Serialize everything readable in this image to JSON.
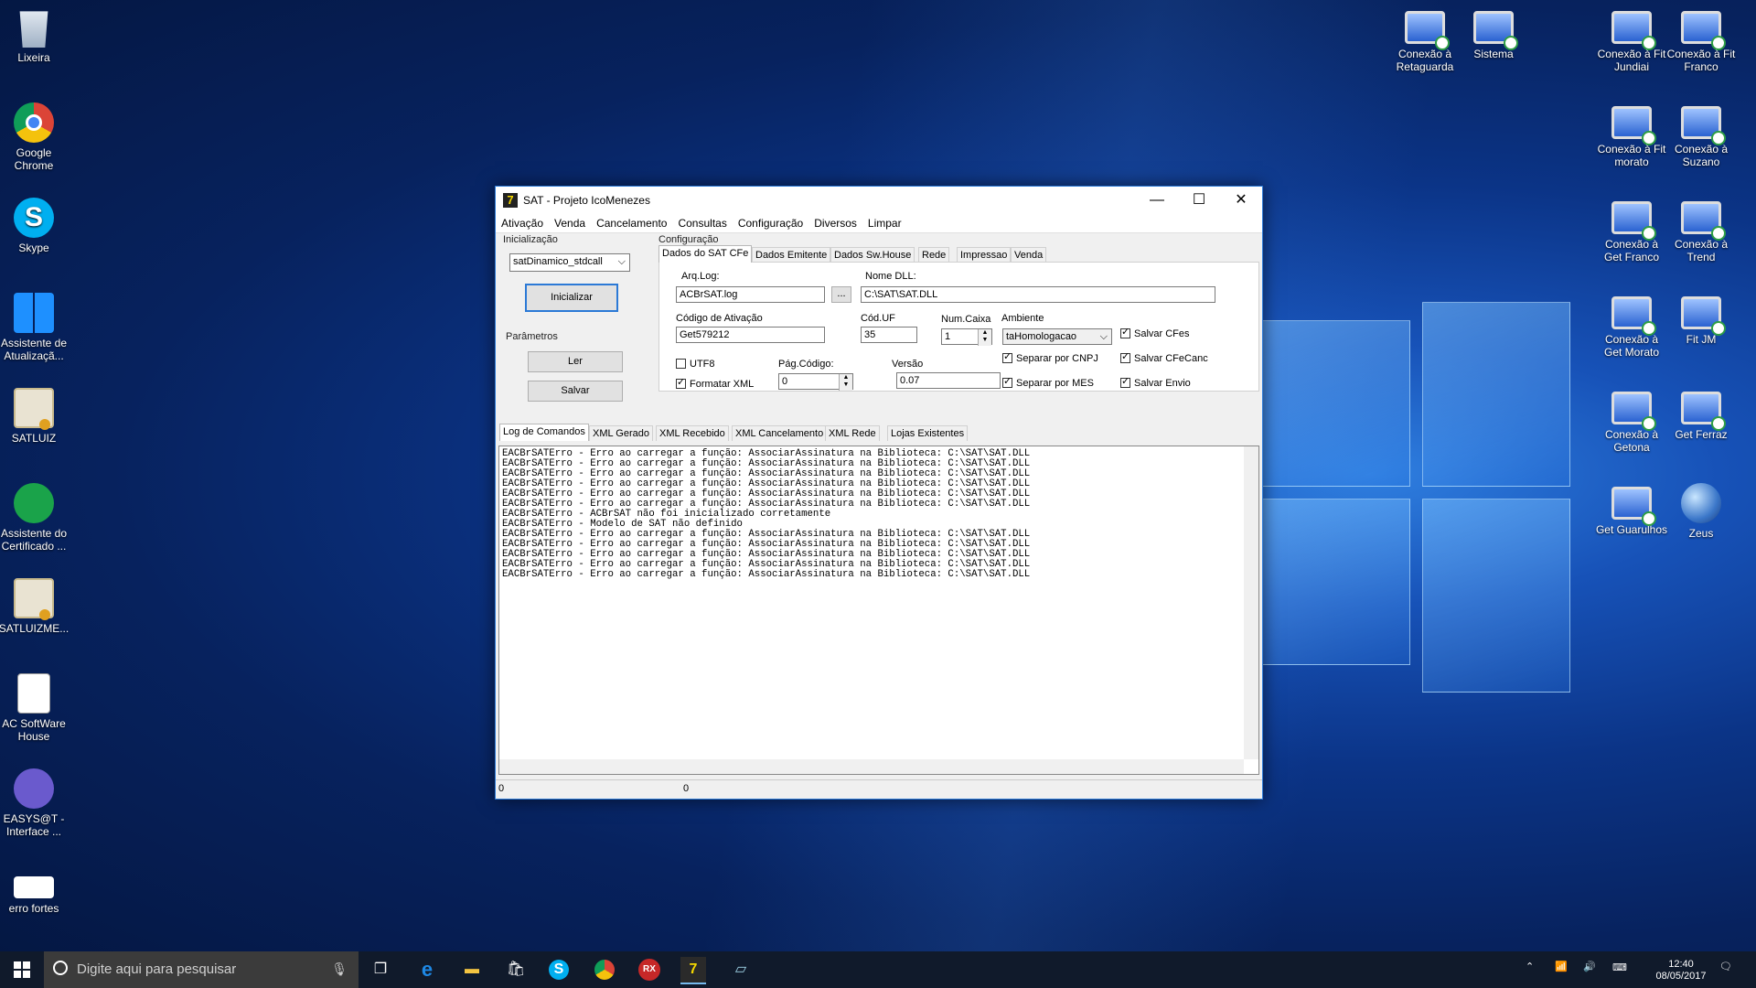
{
  "desktop_left": [
    {
      "name": "desktop-icon-lixeira",
      "label": "Lixeira",
      "img": "bin"
    },
    {
      "name": "desktop-icon-google-chrome",
      "label": "Google Chrome",
      "img": "chrome"
    },
    {
      "name": "desktop-icon-skype",
      "label": "Skype",
      "img": "skype"
    },
    {
      "name": "desktop-icon-assistente-atualizacao",
      "label": "Assistente de Atualizaçã...",
      "img": "winlogo"
    },
    {
      "name": "desktop-icon-satluiz",
      "label": "SATLUIZ",
      "img": "cert"
    },
    {
      "name": "desktop-icon-assistente-certificado",
      "label": "Assistente do Certificado ...",
      "img": "lock"
    },
    {
      "name": "desktop-icon-satluizme",
      "label": "SATLUIZME...",
      "img": "cert"
    },
    {
      "name": "desktop-icon-ac-software-house",
      "label": "AC SoftWare House",
      "img": "doc"
    },
    {
      "name": "desktop-icon-easysat",
      "label": "EASYS@T - Interface ...",
      "img": "easy"
    },
    {
      "name": "desktop-icon-erro-fortes",
      "label": "erro fortes",
      "img": "err"
    }
  ],
  "desktop_right": [
    {
      "name": "desktop-icon-conexao-retaguarda",
      "label": "Conexão à Retaguarda",
      "img": "pc"
    },
    {
      "name": "desktop-icon-sistema",
      "label": "Sistema",
      "img": "pc"
    },
    {
      "name": "desktop-icon-conexao-fit-jundiai",
      "label": "Conexão à Fit Jundiai",
      "img": "pc"
    },
    {
      "name": "desktop-icon-conexao-fit-franco",
      "label": "Conexão à Fit Franco",
      "img": "pc"
    },
    {
      "name": "desktop-icon-conexao-fit-morato",
      "label": "Conexão à Fit morato",
      "img": "pc"
    },
    {
      "name": "desktop-icon-conexao-suzano",
      "label": "Conexão à Suzano",
      "img": "pc"
    },
    {
      "name": "desktop-icon-conexao-get-franco",
      "label": "Conexão à Get Franco",
      "img": "pc"
    },
    {
      "name": "desktop-icon-conexao-trend",
      "label": "Conexão à Trend",
      "img": "pc"
    },
    {
      "name": "desktop-icon-conexao-get-morato",
      "label": "Conexão à Get Morato",
      "img": "pc"
    },
    {
      "name": "desktop-icon-fit-jm",
      "label": "Fit JM",
      "img": "pc"
    },
    {
      "name": "desktop-icon-conexao-getona",
      "label": "Conexão à Getona",
      "img": "pc"
    },
    {
      "name": "desktop-icon-get-ferraz",
      "label": "Get Ferraz",
      "img": "pc"
    },
    {
      "name": "desktop-icon-get-guarulhos",
      "label": "Get Guarulhos",
      "img": "pc"
    },
    {
      "name": "desktop-icon-zeus",
      "label": "Zeus",
      "img": "globe"
    }
  ],
  "window": {
    "title": "SAT - Projeto IcoMenezes",
    "menu": [
      "Ativação",
      "Venda",
      "Cancelamento",
      "Consultas",
      "Configuração",
      "Diversos",
      "Limpar"
    ],
    "inicializacao_label": "Inicialização",
    "modelo_select": "satDinamico_stdcall",
    "inicializar_button": "Inicializar",
    "parametros_label": "Parâmetros",
    "ler_button": "Ler",
    "salvar_button": "Salvar",
    "configuracao_label": "Configuração",
    "config_tabs": [
      "Dados do SAT CFe",
      "Dados Emitente",
      "Dados Sw.House",
      "Rede",
      "Impressao",
      "Venda"
    ],
    "arq_log_label": "Arq.Log:",
    "arq_log_value": "ACBrSAT.log",
    "browse_button": "...",
    "nome_dll_label": "Nome DLL:",
    "nome_dll_value": "C:\\SAT\\SAT.DLL",
    "codigo_ativacao_label": "Código de Ativação",
    "codigo_ativacao_value": "Get579212",
    "cod_uf_label": "Cód.UF",
    "cod_uf_value": "35",
    "num_caixa_label": "Num.Caixa",
    "num_caixa_value": "1",
    "ambiente_label": "Ambiente",
    "ambiente_value": "taHomologacao",
    "utf8_label": "UTF8",
    "pag_codigo_label": "Pág.Código:",
    "pag_codigo_value": "0",
    "versao_label": "Versão",
    "versao_value": "0.07",
    "formatar_xml_label": "Formatar XML",
    "separar_cnpj_label": "Separar por CNPJ",
    "separar_mes_label": "Separar por MES",
    "salvar_cfes_label": "Salvar CFes",
    "salvar_cfecanc_label": "Salvar CFeCanc",
    "salvar_envio_label": "Salvar Envio",
    "log_tabs": [
      "Log de Comandos",
      "XML Gerado",
      "XML Recebido",
      "XML Cancelamento",
      "XML Rede",
      "Lojas Existentes"
    ],
    "log_lines": [
      "EACBrSATErro - Erro ao carregar a função: AssociarAssinatura na Biblioteca: C:\\SAT\\SAT.DLL",
      "EACBrSATErro - Erro ao carregar a função: AssociarAssinatura na Biblioteca: C:\\SAT\\SAT.DLL",
      "EACBrSATErro - Erro ao carregar a função: AssociarAssinatura na Biblioteca: C:\\SAT\\SAT.DLL",
      "EACBrSATErro - Erro ao carregar a função: AssociarAssinatura na Biblioteca: C:\\SAT\\SAT.DLL",
      "EACBrSATErro - Erro ao carregar a função: AssociarAssinatura na Biblioteca: C:\\SAT\\SAT.DLL",
      "EACBrSATErro - Erro ao carregar a função: AssociarAssinatura na Biblioteca: C:\\SAT\\SAT.DLL",
      "EACBrSATErro - ACBrSAT não foi inicializado corretamente",
      "EACBrSATErro - Modelo de SAT não definido",
      "EACBrSATErro - Erro ao carregar a função: AssociarAssinatura na Biblioteca: C:\\SAT\\SAT.DLL",
      "EACBrSATErro - Erro ao carregar a função: AssociarAssinatura na Biblioteca: C:\\SAT\\SAT.DLL",
      "EACBrSATErro - Erro ao carregar a função: AssociarAssinatura na Biblioteca: C:\\SAT\\SAT.DLL",
      "EACBrSATErro - Erro ao carregar a função: AssociarAssinatura na Biblioteca: C:\\SAT\\SAT.DLL",
      "EACBrSATErro - Erro ao carregar a função: AssociarAssinatura na Biblioteca: C:\\SAT\\SAT.DLL"
    ],
    "status_left": "0",
    "status_right": "0"
  },
  "taskbar": {
    "search_placeholder": "Digite aqui para pesquisar",
    "time": "12:40",
    "date": "08/05/2017"
  },
  "colors": {
    "accent": "#2b79d6",
    "taskbar": "#101a2b"
  }
}
